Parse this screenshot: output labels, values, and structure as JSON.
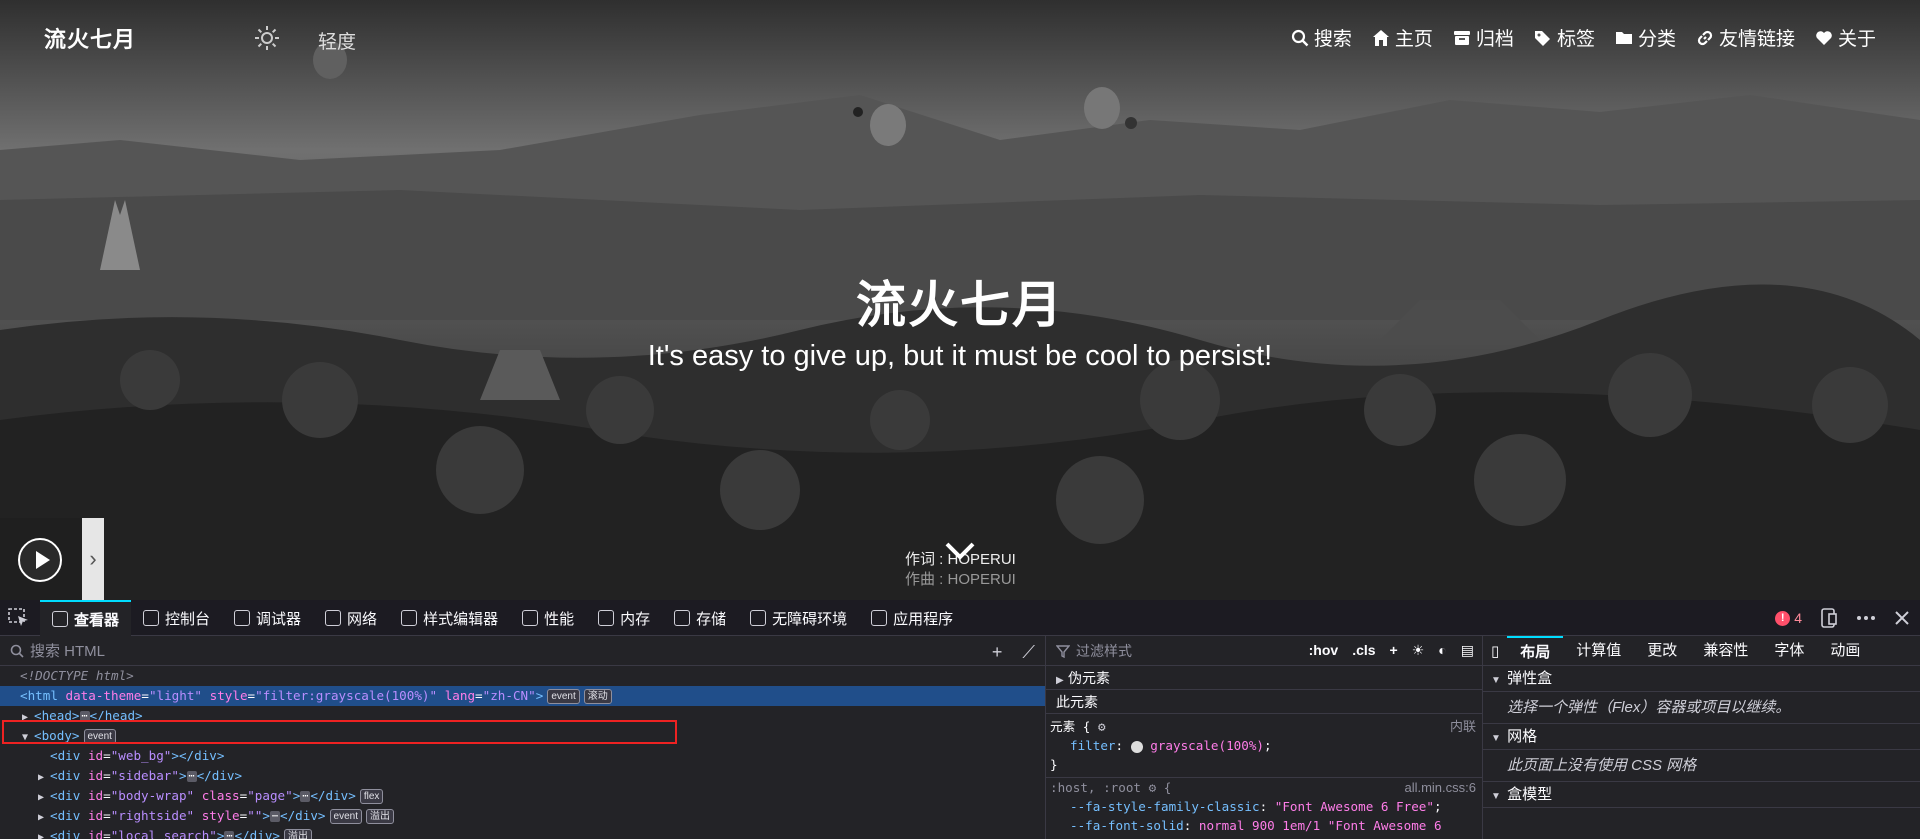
{
  "site": {
    "name": "流火七月",
    "mode_label": "轻度",
    "nav": [
      {
        "icon": "search-icon",
        "label": "搜索"
      },
      {
        "icon": "home-icon",
        "label": "主页"
      },
      {
        "icon": "archive-icon",
        "label": "归档"
      },
      {
        "icon": "tags-icon",
        "label": "标签"
      },
      {
        "icon": "folder-icon",
        "label": "分类"
      },
      {
        "icon": "link-icon",
        "label": "友情链接"
      },
      {
        "icon": "heart-icon",
        "label": "关于"
      }
    ],
    "hero_title": "流火七月",
    "hero_subtitle": "It's easy to give up, but it must be cool to persist!",
    "lyrics": {
      "line1": "作词 : HOPERUI",
      "line2": "作曲 : HOPERUI"
    }
  },
  "devtools": {
    "tabs": [
      "查看器",
      "控制台",
      "调试器",
      "网络",
      "样式编辑器",
      "性能",
      "内存",
      "存储",
      "无障碍环境",
      "应用程序"
    ],
    "error_count": "4",
    "html_search_placeholder": "搜索 HTML",
    "tree": {
      "doctype": "<!DOCTYPE html>",
      "html_open_tag": "<html",
      "html_attr1": "data-theme",
      "html_val1": "\"light\"",
      "html_attr2": "style",
      "html_val2": "\"filter:grayscale(100%)\"",
      "html_attr3": "lang",
      "html_val3": "\"zh-CN\"",
      "html_close": ">",
      "badge_event": "event",
      "badge_scroll": "滚动",
      "head": "<head>",
      "head_close": "</head>",
      "body": "<body>",
      "div_webbg_id": "\"web_bg\"",
      "div_sidebar_id": "\"sidebar\"",
      "div_bodywrap_id": "\"body-wrap\"",
      "div_bodywrap_class": "\"page\"",
      "badge_flex": "flex",
      "div_rightside_id": "\"rightside\"",
      "div_rightside_style": "\"\"",
      "badge_overflow": "溢出",
      "div_localsearch_id": "\"local_search\"",
      "div": "<div",
      "div_close": "</div>",
      "id_attr": "id",
      "class_attr": "class",
      "style_attr": "style",
      "ellipsis": "⋯"
    },
    "rules": {
      "filter_placeholder": "过滤样式",
      "hov": ":hov",
      "cls": ".cls",
      "pseudo": "伪元素",
      "this_element": "此元素",
      "element_selector": "元素 {",
      "inline": "内联",
      "filter_prop": "filter",
      "filter_value": "grayscale(100%)",
      "close_brace": "}",
      "host_selector": ":host, :root",
      "host_source": "all.min.css:6",
      "var1_name": "--fa-style-family-classic",
      "var1_value": "\"Font Awesome 6 Free\"",
      "var2_name": "--fa-font-solid",
      "var2_value": "normal 900 1em/1 \"Font Awesome 6"
    },
    "layout": {
      "tabs": [
        "布局",
        "计算值",
        "更改",
        "兼容性",
        "字体",
        "动画"
      ],
      "flexbox": "弹性盒",
      "flexbox_note": "选择一个弹性（Flex）容器或项目以继续。",
      "grid": "网格",
      "grid_note": "此页面上没有使用 CSS 网格",
      "box_model": "盒模型"
    }
  }
}
